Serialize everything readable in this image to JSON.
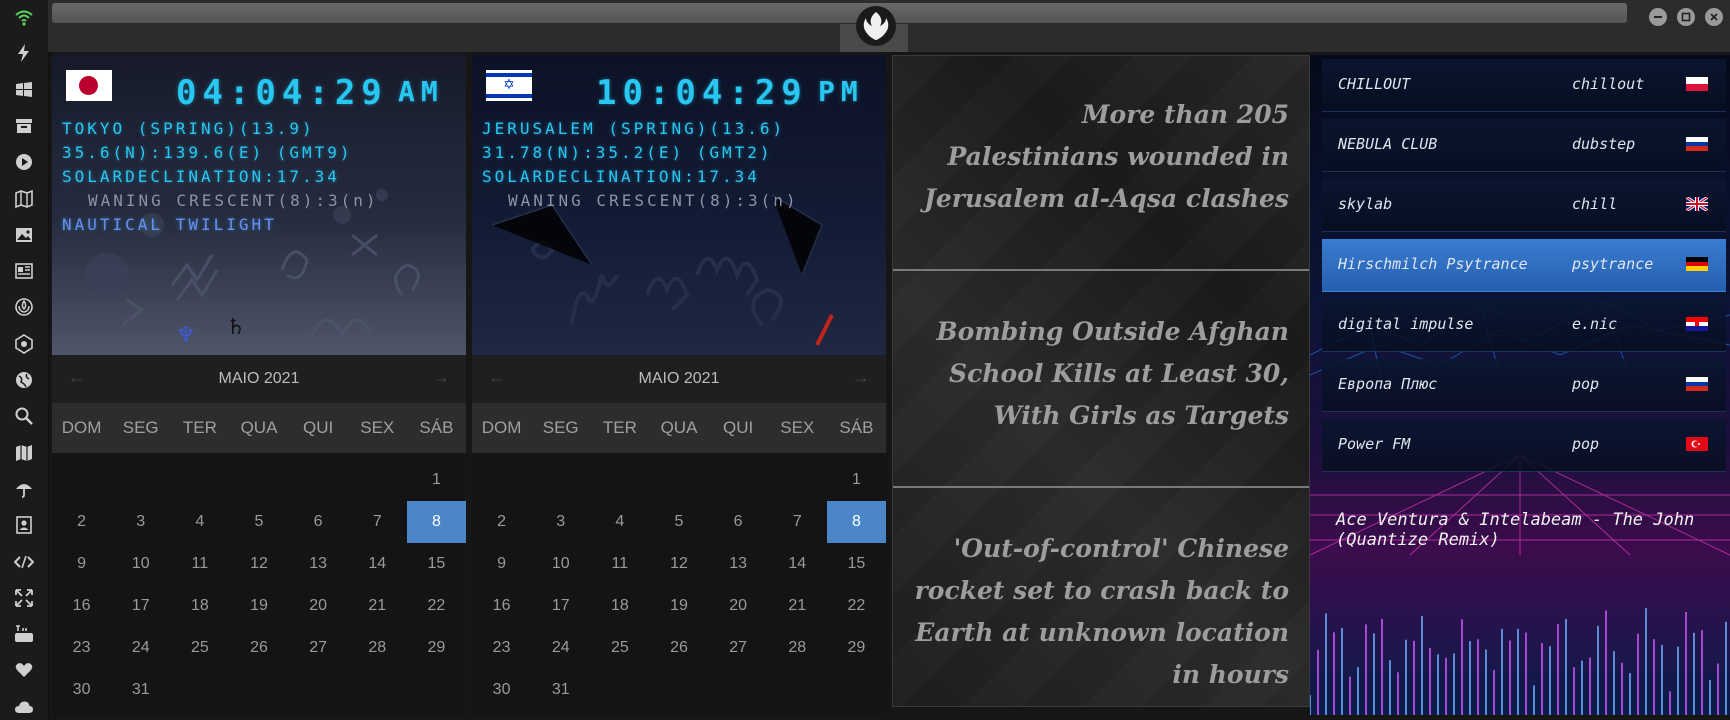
{
  "sidebar": {
    "items": [
      {
        "icon": "wifi-icon"
      },
      {
        "icon": "lightning-icon"
      },
      {
        "icon": "windows-icon"
      },
      {
        "icon": "archive-icon"
      },
      {
        "icon": "play-icon"
      },
      {
        "icon": "map-folded-icon"
      },
      {
        "icon": "image-icon"
      },
      {
        "icon": "news-icon"
      },
      {
        "icon": "rebel-alliance-icon"
      },
      {
        "icon": "hexagon-icon"
      },
      {
        "icon": "globe-icon"
      },
      {
        "icon": "search-icon"
      },
      {
        "icon": "map-icon"
      },
      {
        "icon": "umbrella-icon"
      },
      {
        "icon": "contact-icon"
      },
      {
        "icon": "code-icon"
      },
      {
        "icon": "expand-icon"
      },
      {
        "icon": "youtube-icon"
      },
      {
        "icon": "heart-icon"
      },
      {
        "icon": "cloud-icon"
      }
    ]
  },
  "clocks": [
    {
      "time": "04:04:29",
      "ampm": "AM",
      "line1": "TOKYO (SPRING)(13.9)",
      "line2": "35.6(N):139.6(E) (GMT9)",
      "line3": "SOLARDECLINATION:17.34",
      "moon": "WANING CRESCENT(8):3",
      "moon_unit": "(n)",
      "twilight": "NAUTICAL TWILIGHT",
      "planet_symbols": [
        "♆",
        "♄"
      ]
    },
    {
      "time": "10:04:29",
      "ampm": "PM",
      "line1": "JERUSALEM (SPRING)(13.6)",
      "line2": "31.78(N):35.2(E) (GMT2)",
      "line3": "SOLARDECLINATION:17.34",
      "moon": "WANING CRESCENT(8):3",
      "moon_unit": "(n)"
    }
  ],
  "calendar": {
    "month": "MAIO 2021",
    "prev": "←",
    "next": "→",
    "weekdays": [
      "DOM",
      "SEG",
      "TER",
      "QUA",
      "QUI",
      "SEX",
      "SÁB"
    ],
    "weeks": [
      [
        "",
        "",
        "",
        "",
        "",
        "",
        "1"
      ],
      [
        "2",
        "3",
        "4",
        "5",
        "6",
        "7",
        "8"
      ],
      [
        "9",
        "10",
        "11",
        "12",
        "13",
        "14",
        "15"
      ],
      [
        "16",
        "17",
        "18",
        "19",
        "20",
        "21",
        "22"
      ],
      [
        "23",
        "24",
        "25",
        "26",
        "27",
        "28",
        "29"
      ],
      [
        "30",
        "31",
        "",
        "",
        "",
        "",
        ""
      ]
    ],
    "selected_day": "8"
  },
  "news": [
    "More than 205 Palestinians wounded in Jerusalem al-Aqsa clashes",
    "Bombing Outside Afghan School Kills at Least 30, With Girls as Targets",
    "'Out-of-control' Chinese rocket set to crash back to Earth at unknown location in hours"
  ],
  "radio": {
    "stations": [
      {
        "name": "CHILLOUT",
        "genre": "chillout",
        "flag": "poland-flag-icon"
      },
      {
        "name": "NEBULA CLUB",
        "genre": "dubstep",
        "flag": "russia-flag-icon"
      },
      {
        "name": "skylab",
        "genre": "chill",
        "flag": "uk-flag-icon"
      },
      {
        "name": "Hirschmilch Psytrance",
        "genre": "psytrance",
        "flag": "germany-flag-icon",
        "active": true
      },
      {
        "name": "digital impulse",
        "genre": "e.nic",
        "flag": "croatia-flag-icon"
      },
      {
        "name": "Европа Плюс",
        "genre": "pop",
        "flag": "russia-flag-icon"
      },
      {
        "name": "Power FM",
        "genre": "pop",
        "flag": "turkey-flag-icon"
      }
    ],
    "now_playing": "Ace Ventura & Intelabeam - The John (Quantize Remix)"
  },
  "colors": {
    "lcd": "#28c7f2",
    "twilight": "#6d8cf4",
    "calendar_selected": "#4a86c8",
    "sidebar_wifi": "#5fd35f"
  }
}
